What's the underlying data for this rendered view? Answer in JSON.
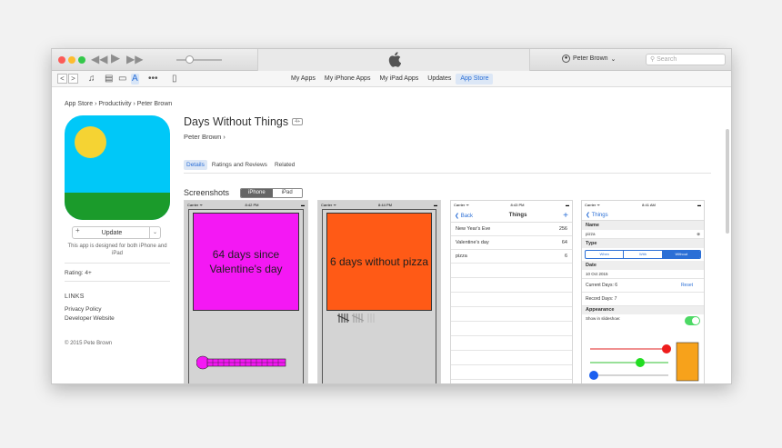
{
  "window": {
    "account": "Peter Brown",
    "search_placeholder": "Search",
    "nav": [
      "My Apps",
      "My iPhone Apps",
      "My iPad Apps",
      "Updates",
      "App Store"
    ],
    "nav_selected": 4,
    "nav_back": "<",
    "nav_fwd": ">"
  },
  "breadcrumb": "App Store › Productivity › Peter Brown",
  "app": {
    "title": "Days Without Things",
    "age_badge": "4+",
    "developer": "Peter Brown ›",
    "update_label": "Update",
    "designed_for": "This app is designed for both iPhone and iPad",
    "rating": "Rating: 4+",
    "links_heading": "LINKS",
    "links": [
      "Privacy Policy",
      "Developer Website"
    ],
    "copyright": "© 2015 Pete Brown",
    "colors": {
      "sky": "#00c8f8",
      "sun": "#f5d333",
      "grass": "#1b9b2b"
    }
  },
  "tabs": [
    "Details",
    "Ratings and Reviews",
    "Related"
  ],
  "screenshots": {
    "heading": "Screenshots",
    "segments": [
      "iPhone",
      "iPad"
    ],
    "shot1": {
      "carrier": "Carrier ᯤ",
      "time": "8:42 PM",
      "card": "64 days since Valentine's day",
      "color": "#f418f4"
    },
    "shot2": {
      "carrier": "Carrier ᯤ",
      "time": "8:44 PM",
      "card": "6 days without pizza",
      "color": "#ff5a16"
    },
    "shot3": {
      "carrier": "Carrier ᯤ",
      "time": "8:43 PM",
      "back": "Back",
      "title": "Things",
      "rows": [
        {
          "name": "New Year's Eve",
          "value": "256"
        },
        {
          "name": "Valentine's day",
          "value": "64"
        },
        {
          "name": "pizza",
          "value": "6"
        }
      ]
    },
    "shot4": {
      "carrier": "Carrier ᯤ",
      "time": "8:41 AM",
      "back": "Things",
      "name_label": "Name",
      "name_value": "pizza",
      "type_label": "Type",
      "type_options": [
        "When",
        "With",
        "Without"
      ],
      "type_selected": 2,
      "date_label": "Date",
      "date_value": "10 Oct 2015",
      "current_days": "Current Days: 6",
      "reset": "Reset",
      "record_days": "Record Days: 7",
      "appearance_label": "Appearance",
      "show_label": "Show in slideshow:"
    }
  }
}
